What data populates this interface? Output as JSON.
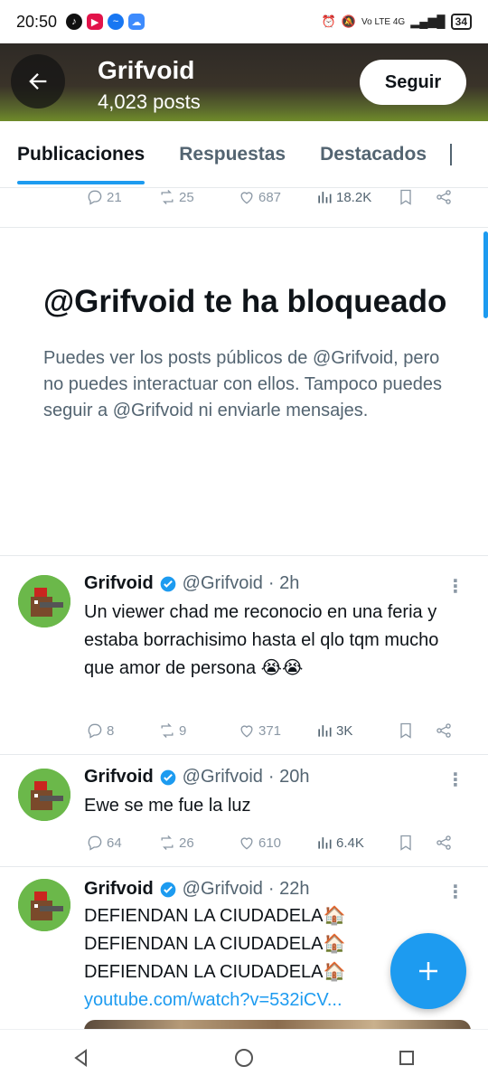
{
  "status_bar": {
    "time": "20:50",
    "network": "Vo LTE 4G",
    "battery": "34"
  },
  "header": {
    "title": "Grifvoid",
    "post_count": "4,023 posts",
    "follow_label": "Seguir"
  },
  "tabs": [
    {
      "label": "Publicaciones",
      "active": true
    },
    {
      "label": "Respuestas",
      "active": false
    },
    {
      "label": "Destacados",
      "active": false
    }
  ],
  "top_actions": {
    "replies": "21",
    "reposts": "25",
    "likes": "687",
    "views": "18.2K"
  },
  "blocked": {
    "title": "@Grifvoid te ha bloqueado",
    "text": "Puedes ver los posts públicos de @Grifvoid, pero no puedes interactuar con ellos. Tampoco puedes seguir a @Grifvoid ni enviarle mensajes."
  },
  "tweets": [
    {
      "name": "Grifvoid",
      "handle": "@Grifvoid",
      "time": "· 2h",
      "text": "Un viewer chad me reconocio en una feria y estaba borrachisimo hasta el qlo tqm mucho que amor de persona 😭😭",
      "text_line2": "😭😭",
      "replies": "8",
      "reposts": "9",
      "likes": "371",
      "views": "3K"
    },
    {
      "name": "Grifvoid",
      "handle": "@Grifvoid",
      "time": "· 20h",
      "text": "Ewe se me fue la luz",
      "replies": "64",
      "reposts": "26",
      "likes": "610",
      "views": "6.4K"
    },
    {
      "name": "Grifvoid",
      "handle": "@Grifvoid",
      "time": "· 22h",
      "lines": [
        "DEFIENDAN LA CIUDADELA🏠",
        "DEFIENDAN LA CIUDADELA🏠",
        "DEFIENDAN LA CIUDADELA🏠"
      ],
      "link": "youtube.com/watch?v=532iCV..."
    }
  ],
  "colors": {
    "accent": "#1d9bf0",
    "text_primary": "#0f1419",
    "text_secondary": "#536471"
  }
}
